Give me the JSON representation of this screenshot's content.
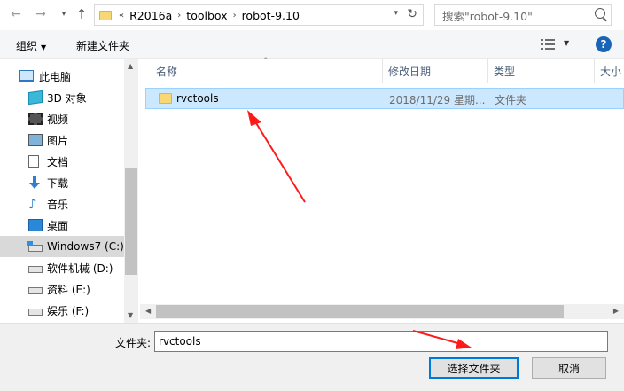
{
  "nav": {
    "back_glyph": "←",
    "forward_glyph": "→",
    "dropdown_glyph": "▾",
    "up_glyph": "↑",
    "overflow": "«",
    "breadcrumbs": [
      "R2016a",
      "toolbox",
      "robot-9.10"
    ],
    "refresh_glyph": "↻"
  },
  "search": {
    "placeholder": "搜索\"robot-9.10\""
  },
  "toolbar": {
    "organize": "组织",
    "new_folder": "新建文件夹",
    "help": "?"
  },
  "sidebar": {
    "items": [
      {
        "label": "此电脑",
        "icon": "monitor-icon"
      },
      {
        "label": "3D 对象",
        "icon": "3d-objects-icon"
      },
      {
        "label": "视频",
        "icon": "video-icon"
      },
      {
        "label": "图片",
        "icon": "picture-icon"
      },
      {
        "label": "文档",
        "icon": "document-icon"
      },
      {
        "label": "下载",
        "icon": "download-icon"
      },
      {
        "label": "音乐",
        "icon": "music-icon"
      },
      {
        "label": "桌面",
        "icon": "desktop-icon"
      },
      {
        "label": "Windows7 (C:)",
        "icon": "windows-drive-icon",
        "selected": true
      },
      {
        "label": "软件机械 (D:)",
        "icon": "drive-icon"
      },
      {
        "label": "资料 (E:)",
        "icon": "drive-icon"
      },
      {
        "label": "娱乐 (F:)",
        "icon": "drive-icon"
      }
    ]
  },
  "columns": {
    "name": "名称",
    "date": "修改日期",
    "type": "类型",
    "size": "大小"
  },
  "files": [
    {
      "name": "rvctools",
      "date": "2018/11/29 星期...",
      "type": "文件夹",
      "icon": "folder-icon"
    }
  ],
  "footer": {
    "filename_label": "文件夹:",
    "filename_value": "rvctools",
    "ok": "选择文件夹",
    "cancel": "取消"
  },
  "colors": {
    "selection_bg": "#cce8ff",
    "selection_border": "#99d1ff",
    "annotation_arrow": "#ff1a1a",
    "accent": "#0078d7"
  }
}
